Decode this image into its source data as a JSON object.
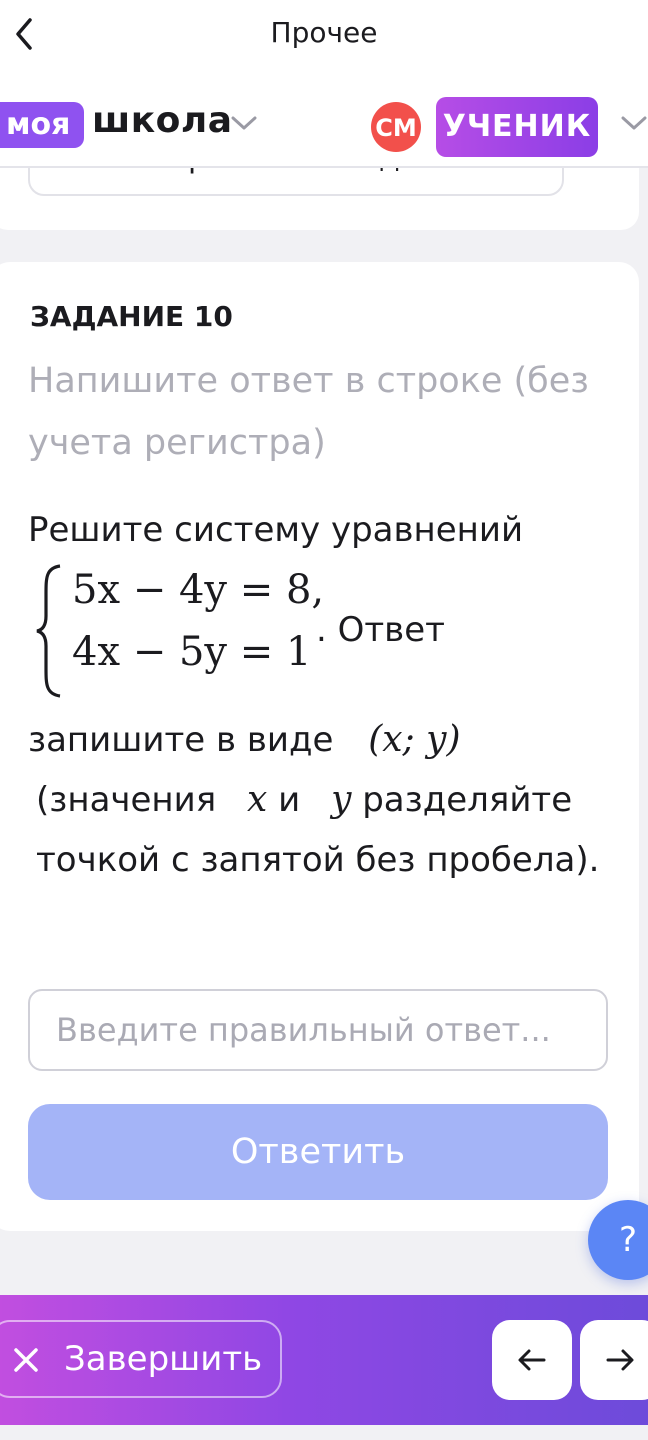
{
  "topbar": {
    "title": "Прочее"
  },
  "brand": {
    "logo_part1": "моя",
    "logo_part2": "школа",
    "avatar_initials": "СМ",
    "role": "УЧЕНИК",
    "colors": {
      "logo": "#8f52f0",
      "avatar": "#f2504b",
      "role": "#9b45e6"
    }
  },
  "prev_card": {
    "button_label": "Отображение медиа"
  },
  "task": {
    "label": "ЗАДАНИЕ 10",
    "instruction": "Напишите ответ в строке (без учета регистра)",
    "text_intro": "Решите систему уравнений",
    "equation1": "5x − 4y = 8,",
    "equation2": "4x − 5y = 1",
    "text_after_system": ". Ответ",
    "text_format_prefix": "запишите в виде",
    "format": "(x; y)",
    "text_note_1": "(значения",
    "var_x": "x",
    "text_and": "и",
    "var_y": "y",
    "text_note_2": "разделяйте точкой с запятой без пробела)."
  },
  "answer": {
    "placeholder": "Введите правильный ответ...",
    "submit_label": "Ответить",
    "submit_color": "#a4b4f7"
  },
  "help": {
    "label": "?"
  },
  "bottom": {
    "finish_label": "Завершить",
    "prev_icon": "arrow-left-icon",
    "next_icon": "arrow-right-icon"
  }
}
